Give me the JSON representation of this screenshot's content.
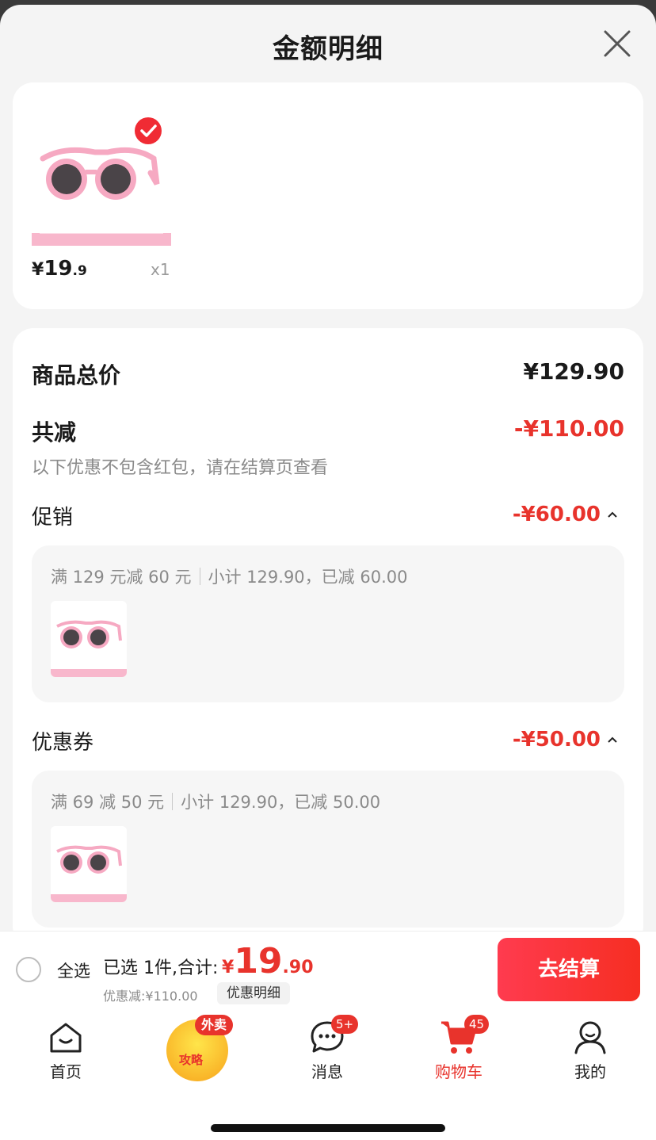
{
  "header": {
    "title": "金额明细"
  },
  "product": {
    "price_yen": "¥",
    "price_int": "19",
    "price_dec": ".9",
    "qty": "x1",
    "selected": true
  },
  "summary": {
    "total_label": "商品总价",
    "total_value": "¥129.90",
    "reduce_label": "共减",
    "reduce_value": "-¥110.00",
    "note": "以下优惠不包含红包，请在结算页查看",
    "promo": {
      "label": "促销",
      "value": "-¥60.00",
      "rule": "满 129 元减 60 元",
      "subtotal": "小计 129.90，已减 60.00"
    },
    "coupon": {
      "label": "优惠券",
      "value": "-¥50.00",
      "rule": "满 69 减 50 元",
      "subtotal": "小计 129.90，已减 50.00"
    }
  },
  "bottom_bar": {
    "select_all": "全选",
    "selected_text": "已选 1件,合计:",
    "price_yen": "¥",
    "price_int": "19",
    "price_dec": ".90",
    "discount_text": "优惠减:¥110.00",
    "detail_label": "优惠明细",
    "checkout_label": "去结算"
  },
  "tabbar": {
    "home": "首页",
    "promo_badge": "外卖",
    "promo_text": "攻略",
    "messages": "消息",
    "messages_badge": "5+",
    "cart": "购物车",
    "cart_badge": "45",
    "me": "我的"
  },
  "colors": {
    "accent": "#e8332c",
    "checkout_start": "#ff3b4f",
    "checkout_end": "#f62e22"
  }
}
